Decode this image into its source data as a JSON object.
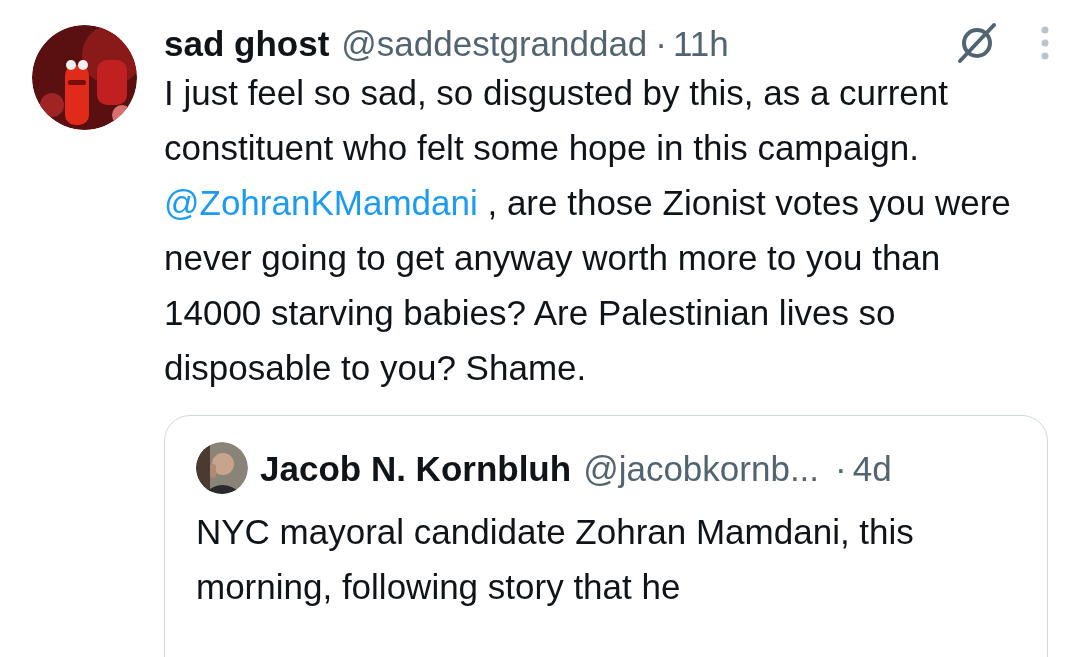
{
  "tweet": {
    "display_name": "sad ghost",
    "handle": "@saddestgranddad",
    "separator": "·",
    "time": "11h",
    "text_before": "I just feel so sad, so disgusted by this, as a current constituent who felt some hope in this campaign. ",
    "mention": "@ZohranKMamdani",
    "text_after": " , are those Zionist votes you were never going to get anyway worth more to you than 14000 starving babies? Are Palestinian lives so disposable to you? Shame.",
    "quote": {
      "display_name": "Jacob N. Kornbluh",
      "handle": "@jacobkornb...",
      "separator": "·",
      "time": "4d",
      "text": "NYC mayoral candidate Zohran Mamdani, this morning, following story that he"
    }
  }
}
